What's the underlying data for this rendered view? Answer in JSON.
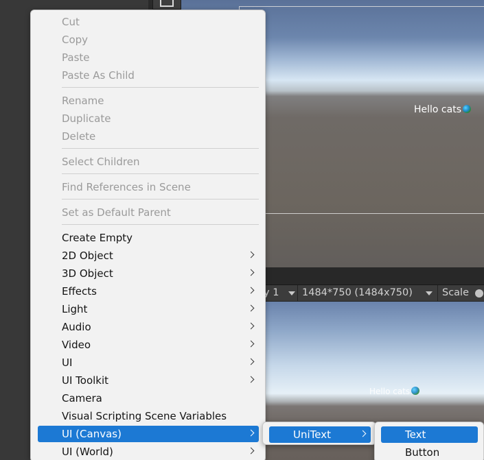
{
  "scene": {
    "text": "Hello cats"
  },
  "game": {
    "display_value": "y 1",
    "resolution_value": "1484*750 (1484x750)",
    "scale_label": "Scale",
    "text": "Hello cats"
  },
  "context_menu": {
    "group1": {
      "cut": "Cut",
      "copy": "Copy",
      "paste": "Paste",
      "paste_as_child": "Paste As Child"
    },
    "group2": {
      "rename": "Rename",
      "duplicate": "Duplicate",
      "delete": "Delete"
    },
    "group3": {
      "select_children": "Select Children"
    },
    "group4": {
      "find_references": "Find References in Scene"
    },
    "group5": {
      "set_default_parent": "Set as Default Parent"
    },
    "create": {
      "create_empty": "Create Empty",
      "object_2d": "2D Object",
      "object_3d": "3D Object",
      "effects": "Effects",
      "light": "Light",
      "audio": "Audio",
      "video": "Video",
      "ui": "UI",
      "ui_toolkit": "UI Toolkit",
      "camera": "Camera",
      "visual_scripting": "Visual Scripting Scene Variables",
      "ui_canvas": "UI (Canvas)",
      "ui_world": "UI (World)"
    }
  },
  "submenu_canvas": {
    "unitext": "UniText"
  },
  "submenu_unitext": {
    "text": "Text",
    "button": "Button"
  },
  "colors": {
    "selection": "#1c79d4",
    "menu_background": "#f2f2f2",
    "disabled_text": "#9a9a9a"
  }
}
